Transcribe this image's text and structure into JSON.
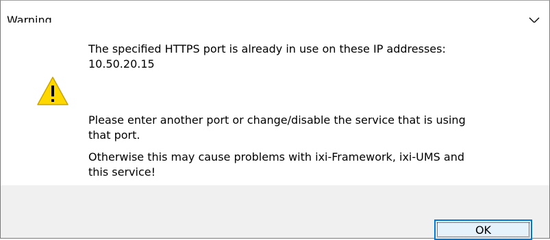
{
  "dialog": {
    "title": "Warning",
    "icon": "warning-triangle-icon",
    "message_line1": "The specified HTTPS port is already in use on these IP addresses:",
    "message_line2": "10.50.20.15",
    "message_line3": "Please enter another port or change/disable the service that is using",
    "message_line4": "that port.",
    "message_line5": "Otherwise this may cause problems with ixi-Framework, ixi-UMS and",
    "message_line6": "this service!",
    "ok_label": "OK"
  },
  "colors": {
    "warning_yellow": "#ffd800",
    "button_border": "#0078d7",
    "footer_bg": "#f0f0f0"
  }
}
